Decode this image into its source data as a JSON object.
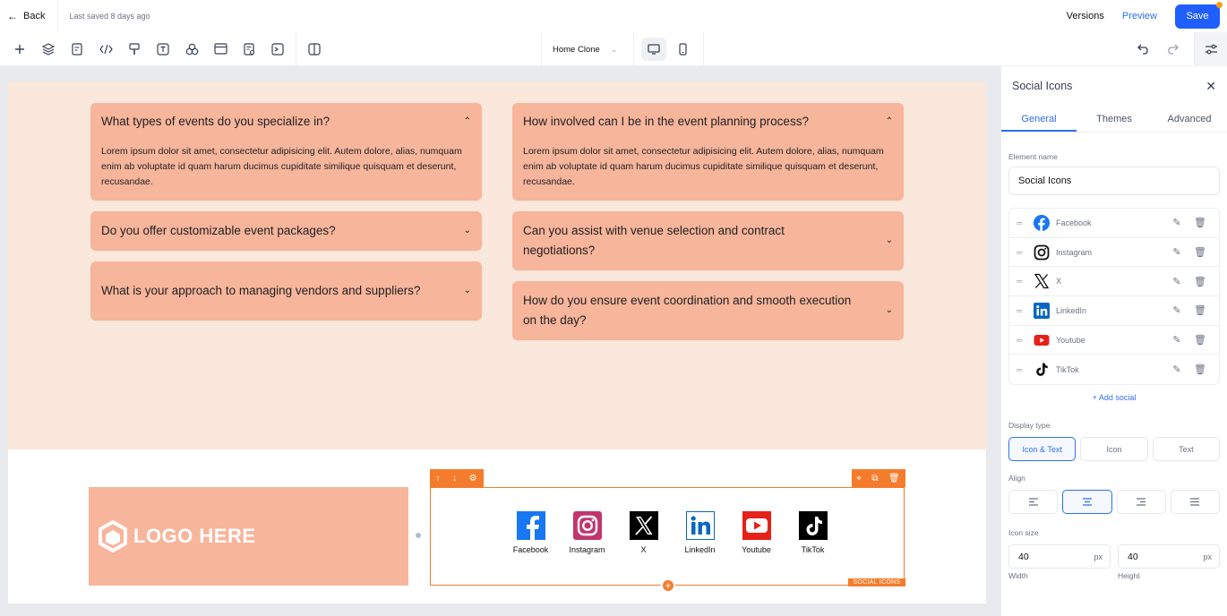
{
  "topbar": {
    "back_label": "Back",
    "last_saved": "Last saved 8 days ago",
    "versions_label": "Versions",
    "preview_label": "Preview",
    "save_label": "Save"
  },
  "toolbar": {
    "tools": [
      "add-icon",
      "layers-icon",
      "pages-icon",
      "code-icon",
      "brush-icon",
      "text-icon",
      "components-icon",
      "section-icon",
      "forms-icon",
      "media-icon",
      "columns-icon"
    ],
    "page_name": "Home Clone",
    "devices": [
      "desktop-icon",
      "mobile-icon"
    ],
    "active_device": "desktop"
  },
  "faq": {
    "left": [
      {
        "question": "What types of events do you specialize in?",
        "answer": "Lorem ipsum dolor sit amet, consectetur adipisicing elit. Autem dolore, alias, numquam enim ab voluptate id quam harum ducimus cupiditate similique quisquam et deserunt, recusandae.",
        "expanded": true
      },
      {
        "question": "Do you offer customizable event packages?",
        "answer": "",
        "expanded": false
      },
      {
        "question": "What is your approach to managing vendors and suppliers?",
        "answer": "",
        "expanded": false
      }
    ],
    "right": [
      {
        "question": "How involved can I be in the event planning process?",
        "answer": "Lorem ipsum dolor sit amet, consectetur adipisicing elit. Autem dolore, alias, numquam enim ab voluptate id quam harum ducimus cupiditate similique quisquam et deserunt, recusandae.",
        "expanded": true
      },
      {
        "question": "Can you assist with venue selection and contract negotiations?",
        "answer": "",
        "expanded": false
      },
      {
        "question": "How do you ensure event coordination and smooth execution on the day?",
        "answer": "",
        "expanded": false
      }
    ]
  },
  "footer": {
    "logo_text": "LOGO HERE",
    "block_label": "SOCIAL ICONS",
    "socials": [
      {
        "name": "Facebook",
        "icon": "facebook-icon"
      },
      {
        "name": "Instagram",
        "icon": "instagram-icon"
      },
      {
        "name": "X",
        "icon": "x-icon"
      },
      {
        "name": "LinkedIn",
        "icon": "linkedin-icon"
      },
      {
        "name": "Youtube",
        "icon": "youtube-icon"
      },
      {
        "name": "TikTok",
        "icon": "tiktok-icon"
      }
    ]
  },
  "panel": {
    "title": "Social Icons",
    "tabs": [
      "General",
      "Themes",
      "Advanced"
    ],
    "active_tab": "General",
    "element_name_label": "Element name",
    "element_name_value": "Social Icons",
    "socials": [
      "Facebook",
      "Instagram",
      "X",
      "LinkedIn",
      "Youtube",
      "TikTok"
    ],
    "add_social_label": "+ Add social",
    "display_type_label": "Display type",
    "display_types": [
      "Icon & Text",
      "Icon",
      "Text"
    ],
    "active_display_type": "Icon & Text",
    "align_label": "Align",
    "align_options": [
      "align-left-icon",
      "align-center-icon",
      "align-right-icon",
      "align-justify-icon"
    ],
    "active_align": "center",
    "icon_size_label": "Icon size",
    "width_value": "40",
    "height_value": "40",
    "unit": "px",
    "width_label": "Width",
    "height_label": "Height"
  },
  "colors": {
    "accent": "#2f6fed",
    "faq_card": "#f7b59c",
    "faq_bg": "#fae8dc",
    "selection": "#f57c2c"
  }
}
